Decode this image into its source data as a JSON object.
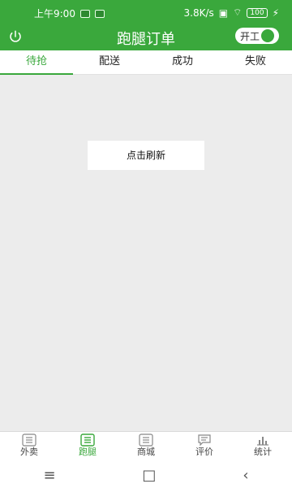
{
  "status": {
    "time": "上午9:00",
    "speed": "3.8K/s",
    "battery": "100"
  },
  "header": {
    "title": "跑腿订单",
    "switch_label": "开工"
  },
  "tabs": [
    {
      "label": "待抢",
      "active": true
    },
    {
      "label": "配送",
      "active": false
    },
    {
      "label": "成功",
      "active": false
    },
    {
      "label": "失败",
      "active": false
    }
  ],
  "main": {
    "refresh_label": "点击刷新"
  },
  "bottom_nav": [
    {
      "label": "外卖",
      "icon": "document-icon",
      "active": false
    },
    {
      "label": "跑腿",
      "icon": "document-icon",
      "active": true
    },
    {
      "label": "商城",
      "icon": "document-icon",
      "active": false
    },
    {
      "label": "评价",
      "icon": "comment-icon",
      "active": false
    },
    {
      "label": "统计",
      "icon": "bar-chart-icon",
      "active": false
    }
  ],
  "system_nav": {
    "menu_icon": "menu-icon",
    "home_icon": "home-icon",
    "back_icon": "back-icon"
  },
  "colors": {
    "primary": "#3aa83c",
    "background": "#ececec"
  }
}
